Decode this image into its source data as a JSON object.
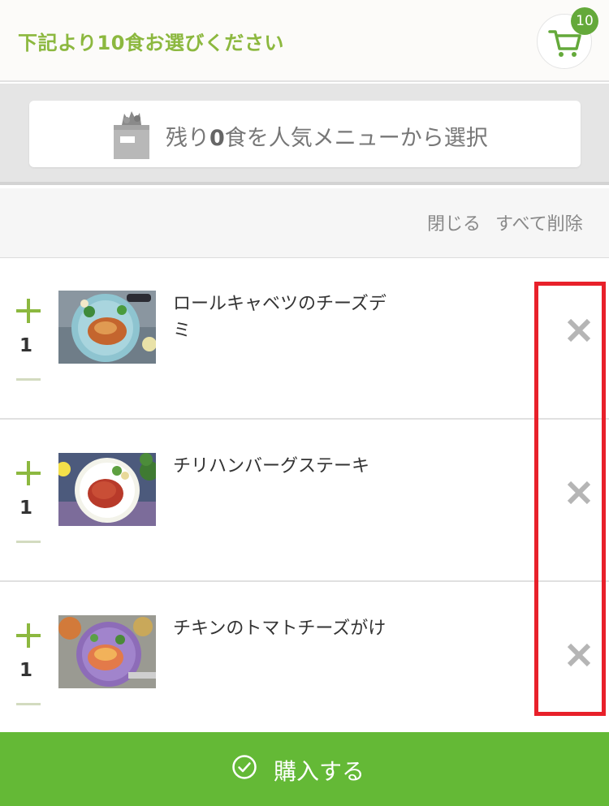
{
  "header": {
    "title": "下記より10食お選びください",
    "cart_count": "10",
    "cart_icon": "cart-icon"
  },
  "popular": {
    "prefix": "残り",
    "count": "0",
    "suffix": "食を人気メニューから選択",
    "bag_icon": "shopping-bag-icon"
  },
  "actions": {
    "close_label": "閉じる",
    "delete_all_label": "すべて削除"
  },
  "items": [
    {
      "name": "ロールキャベツのチーズデミ",
      "qty": "1"
    },
    {
      "name": "チリハンバーグステーキ",
      "qty": "1"
    },
    {
      "name": "チキンのトマトチーズがけ",
      "qty": "1"
    }
  ],
  "footer": {
    "purchase_label": "購入する",
    "check_icon": "check-circle-icon"
  },
  "colors": {
    "accent": "#8cb83f",
    "badge": "#64a93a",
    "purchase": "#64b936",
    "highlight": "#e8202a"
  }
}
